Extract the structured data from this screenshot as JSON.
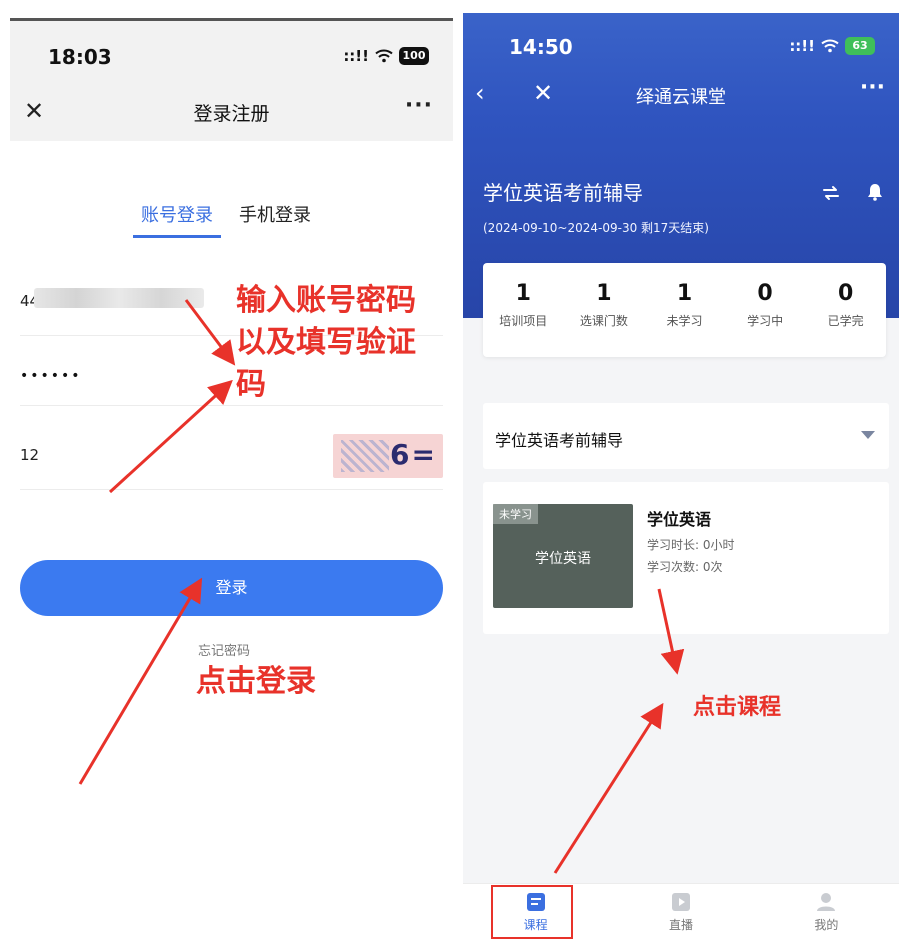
{
  "left_phone": {
    "status": {
      "time": "18:03",
      "signal": "::!!",
      "wifi": "wifi-icon",
      "battery": "100"
    },
    "nav": {
      "title": "登录注册",
      "close": "✕",
      "more": "···"
    },
    "tabs": {
      "active": "账号登录",
      "other": "手机登录"
    },
    "fields": {
      "account_value": "44",
      "password_value": "••••••",
      "captcha_input": "12",
      "captcha_image_text": "6="
    },
    "login_button": "登录",
    "forgot_password": "忘记密码",
    "annotations": {
      "enter_account_line1": "输入账号密码",
      "enter_account_line2": "以及填写验证",
      "enter_account_line3": "码",
      "click_login": "点击登录"
    }
  },
  "right_phone": {
    "status": {
      "time": "14:50",
      "signal": "::!!",
      "wifi": "wifi-icon",
      "battery": "63"
    },
    "nav": {
      "back": "‹",
      "close": "✕",
      "title": "绎通云课堂",
      "more": "···"
    },
    "course": {
      "title": "学位英语考前辅导",
      "range": "(2024-09-10~2024-09-30 剩17天结束)"
    },
    "stats": [
      {
        "num": "1",
        "label": "培训项目"
      },
      {
        "num": "1",
        "label": "选课门数"
      },
      {
        "num": "1",
        "label": "未学习"
      },
      {
        "num": "0",
        "label": "学习中"
      },
      {
        "num": "0",
        "label": "已学完"
      }
    ],
    "dropdown": {
      "label": "学位英语考前辅导"
    },
    "card": {
      "tag": "未学习",
      "thumb_text": "学位英语",
      "title": "学位英语",
      "duration": "学习时长: 0小时",
      "count": "学习次数: 0次"
    },
    "annotation": "点击课程",
    "tabbar": [
      {
        "label": "课程",
        "icon": "course-icon"
      },
      {
        "label": "直播",
        "icon": "live-icon"
      },
      {
        "label": "我的",
        "icon": "profile-icon"
      }
    ]
  },
  "colors": {
    "accent": "#3b7af0",
    "annotation_red": "#e8322a",
    "hero_blue": "#2f54bf"
  }
}
